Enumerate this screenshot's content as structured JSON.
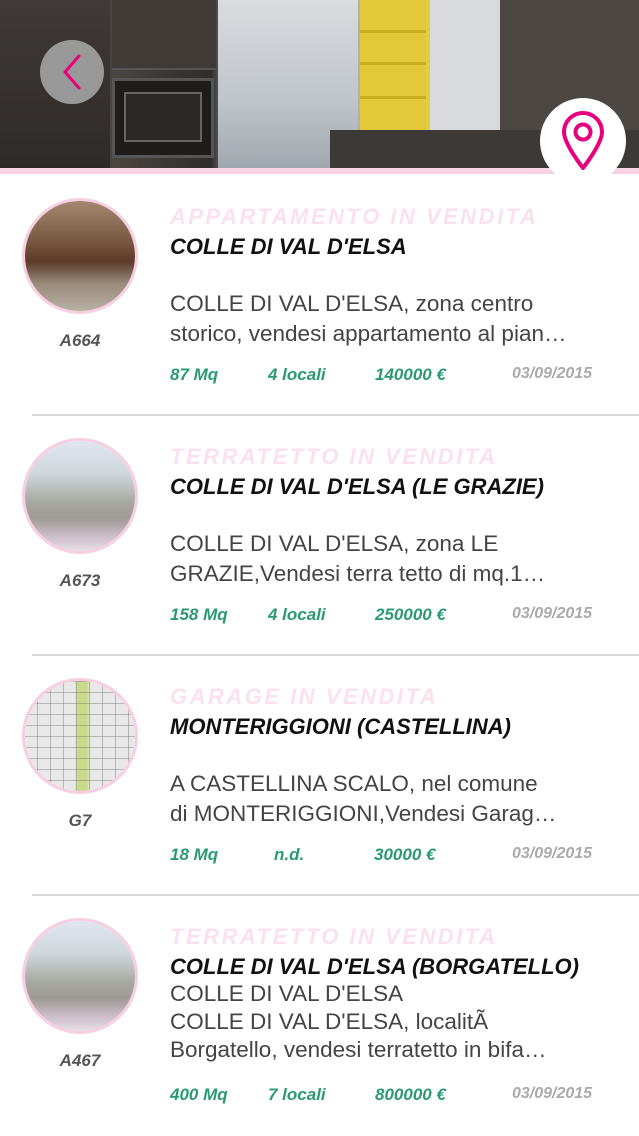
{
  "header": {
    "back_icon": "chevron-left-icon",
    "map_icon": "map-pin-icon",
    "accent_color": "#e6007e"
  },
  "listings": [
    {
      "type": "APPARTAMENTO IN VENDITA",
      "town": "COLLE DI VAL D'ELSA",
      "desc_line1": "COLLE DI VAL D'ELSA, zona centro",
      "desc_line2": "storico, vendesi appartamento al pian…",
      "code": "A664",
      "size": "87 Mq",
      "rooms": "4 locali",
      "price": "140000 €",
      "date": "03/09/2015"
    },
    {
      "type": "TERRATETTO IN VENDITA",
      "town": "COLLE DI VAL D'ELSA (LE GRAZIE)",
      "desc_line1": "COLLE DI VAL D'ELSA, zona LE",
      "desc_line2": "GRAZIE,Vendesi terra tetto di mq.1…",
      "code": "A673",
      "size": "158 Mq",
      "rooms": "4 locali",
      "price": "250000 €",
      "date": "03/09/2015"
    },
    {
      "type": "GARAGE IN VENDITA",
      "town": "MONTERIGGIONI (CASTELLINA)",
      "desc_line1": "A CASTELLINA SCALO, nel comune",
      "desc_line2": "di MONTERIGGIONI,Vendesi Garag…",
      "code": "G7",
      "size": "18 Mq",
      "rooms": "n.d.",
      "price": "30000 €",
      "date": "03/09/2015"
    },
    {
      "type": "TERRATETTO IN VENDITA",
      "town": "COLLE DI VAL D'ELSA (BORGATELLO)",
      "desc_line0": "COLLE DI VAL D'ELSA",
      "desc_line1": "COLLE DI VAL D'ELSA, localitÃ",
      "desc_line2": "Borgatello, vendesi terratetto in bifa…",
      "code": "A467",
      "size": "400 Mq",
      "rooms": "7 locali",
      "price": "800000 €",
      "date": "03/09/2015"
    }
  ]
}
